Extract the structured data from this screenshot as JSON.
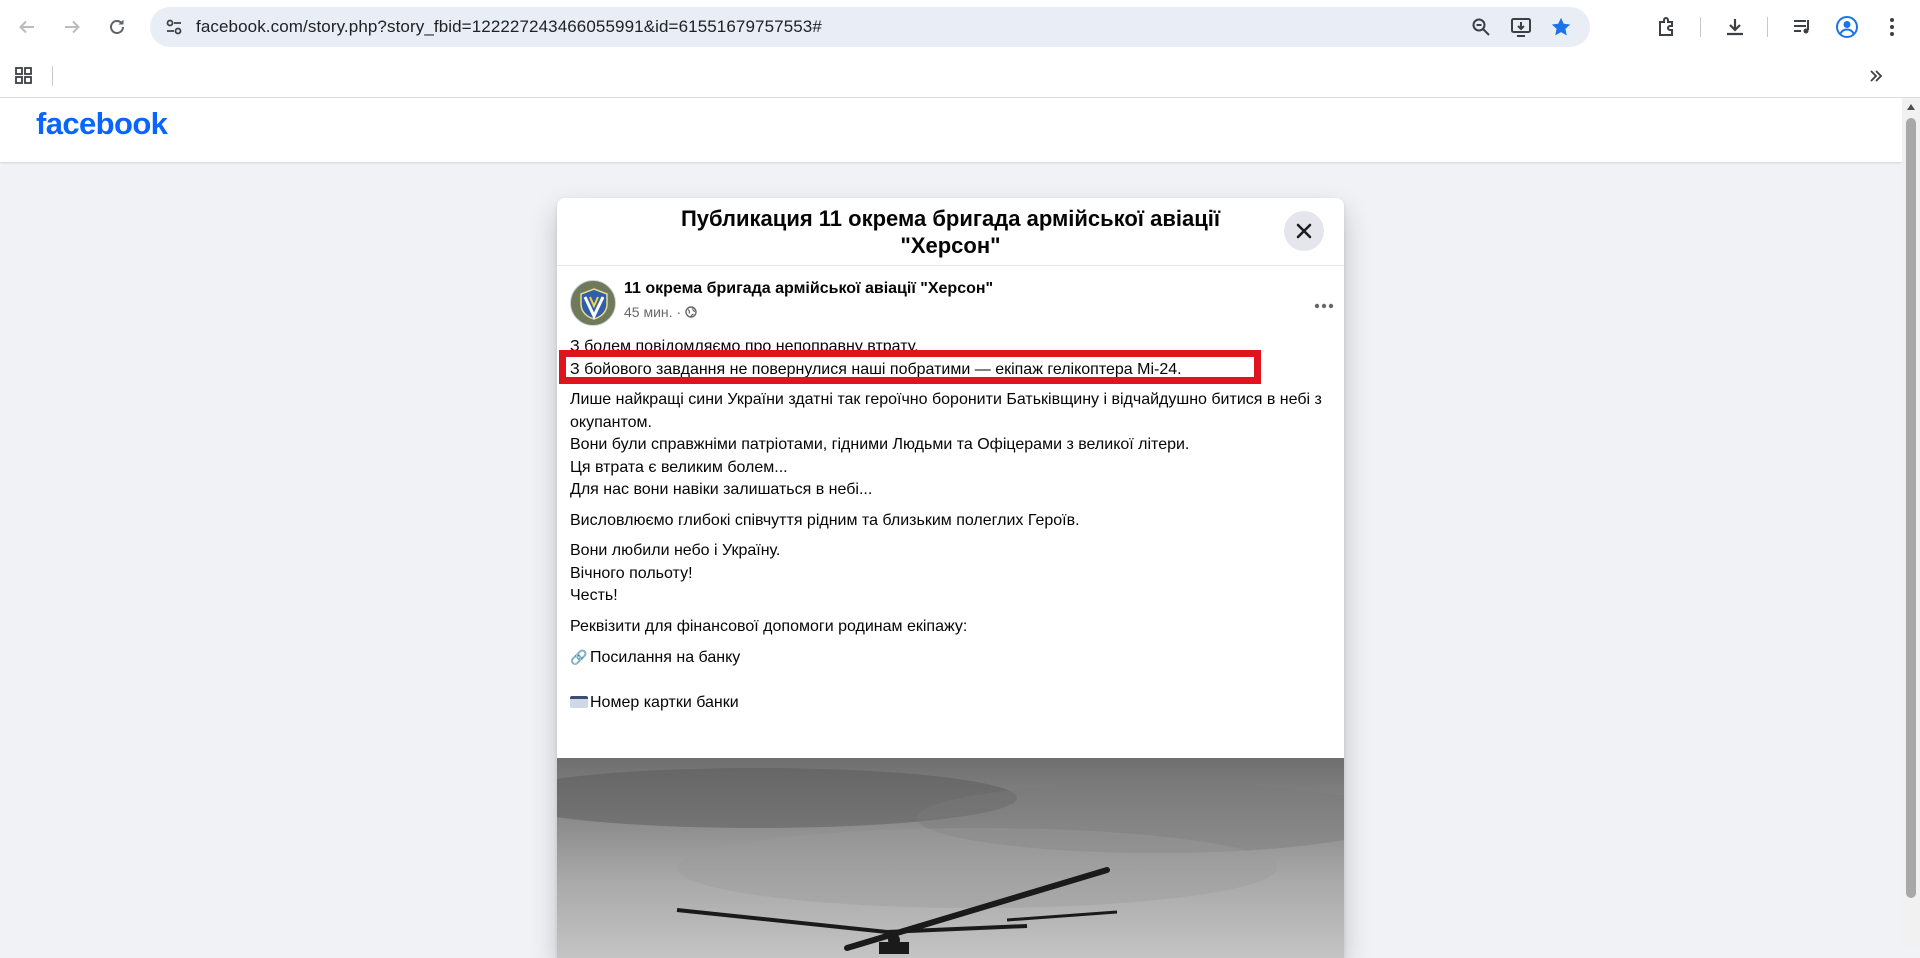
{
  "browser": {
    "url": "facebook.com/story.php?story_fbid=122227243466055991&id=61551679757553#"
  },
  "facebook": {
    "logo": "facebook"
  },
  "modal": {
    "title": "Публикация 11 окрема бригада армійської авіації \"Херсон\"",
    "author_name": "11 окрема бригада армійської авіації \"Херсон\"",
    "post_time": "45 мин.",
    "meta_separator": "·",
    "post_lines": {
      "l1": "З болем повідомляємо про непоправну втрату.",
      "l2": "З бойового завдання не повернулися наші побратими — екіпаж гелікоптера Мі-24.",
      "l3": "Лише найкращі сини України здатні так героїчно боронити Батьківщину і відчайдушно битися в небі з окупантом.",
      "l4": "Вони були справжніми патріотами, гідними Людьми та Офіцерами з великої літери.",
      "l5": "Ця втрата є великим болем...",
      "l6": "Для нас вони навіки залишаться в небі...",
      "l7": "Висловлюємо глибокі співчуття рідним та близьким полеглих Героїв.",
      "l8": "Вони любили небо і Україну.",
      "l9": "Вічного польоту!",
      "l10": "Честь!",
      "l11": "Реквізити для фінансової допомоги родинам екіпажу:",
      "l12": "Посилання на банку",
      "l13": "Номер картки банки"
    },
    "link_emoji": "🔗",
    "highlight_color": "#e0141f"
  },
  "colors": {
    "fb_blue": "#0866ff",
    "page_bg": "#f0f2f5",
    "omnibox_bg": "#e9edf6",
    "bookmark_star": "#1a73e8"
  }
}
